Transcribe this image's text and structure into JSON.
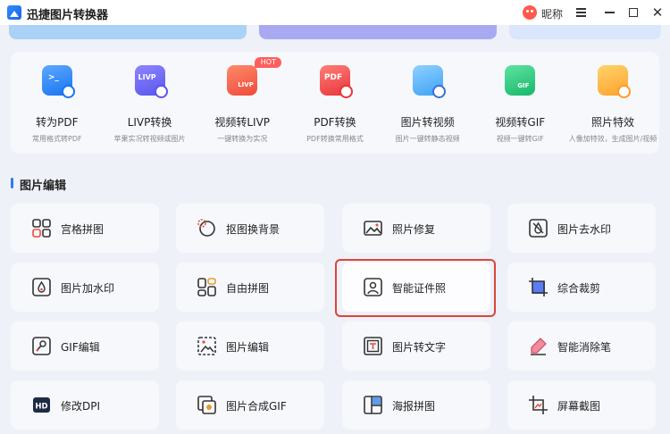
{
  "app": {
    "title": "迅捷图片转换器",
    "nickname": "昵称"
  },
  "window_controls": {
    "menu": "≡",
    "minimize": "–",
    "maximize": "□",
    "close": "✕"
  },
  "tools": [
    {
      "label": "转为PDF",
      "desc": "常用格式转PDF",
      "icon": "image-to-pdf-icon",
      "glyph": ">_"
    },
    {
      "label": "LIVP转换",
      "desc": "苹果实况转视频或图片",
      "icon": "livp-convert-icon",
      "glyph": "LIVP"
    },
    {
      "label": "视频转LIVP",
      "desc": "一键转换为实况",
      "icon": "video-to-livp-icon",
      "glyph": "LIVP",
      "badge": "HOT"
    },
    {
      "label": "PDF转换",
      "desc": "PDF转换常用格式",
      "icon": "pdf-convert-icon",
      "glyph": "PDF"
    },
    {
      "label": "图片转视频",
      "desc": "图片一键转静态视频",
      "icon": "image-to-video-icon",
      "glyph": ""
    },
    {
      "label": "视频转GIF",
      "desc": "视频一键转GIF",
      "icon": "video-to-gif-icon",
      "glyph": "GIF"
    },
    {
      "label": "照片特效",
      "desc": "人像加特效，生成图片/视频",
      "icon": "photo-effect-icon",
      "glyph": ""
    }
  ],
  "section": {
    "title": "图片编辑"
  },
  "features": [
    {
      "label": "宫格拼图",
      "icon": "grid-collage-icon"
    },
    {
      "label": "抠图换背景",
      "icon": "cutout-background-icon"
    },
    {
      "label": "照片修复",
      "icon": "photo-repair-icon"
    },
    {
      "label": "图片去水印",
      "icon": "remove-watermark-icon"
    },
    {
      "label": "图片加水印",
      "icon": "add-watermark-icon"
    },
    {
      "label": "自由拼图",
      "icon": "free-collage-icon"
    },
    {
      "label": "智能证件照",
      "icon": "id-photo-icon"
    },
    {
      "label": "综合裁剪",
      "icon": "crop-icon"
    },
    {
      "label": "GIF编辑",
      "icon": "gif-edit-icon"
    },
    {
      "label": "图片编辑",
      "icon": "image-edit-icon"
    },
    {
      "label": "图片转文字",
      "icon": "image-to-text-icon"
    },
    {
      "label": "智能消除笔",
      "icon": "eraser-pen-icon"
    },
    {
      "label": "修改DPI",
      "icon": "dpi-icon",
      "glyph": "HD"
    },
    {
      "label": "图片合成GIF",
      "icon": "images-to-gif-icon"
    },
    {
      "label": "海报拼图",
      "icon": "poster-collage-icon"
    },
    {
      "label": "屏幕截图",
      "icon": "screenshot-icon"
    }
  ],
  "colors": {
    "accent": "#2f7bf5",
    "highlight": "#d9463a",
    "hot": "#ff5e5e"
  }
}
